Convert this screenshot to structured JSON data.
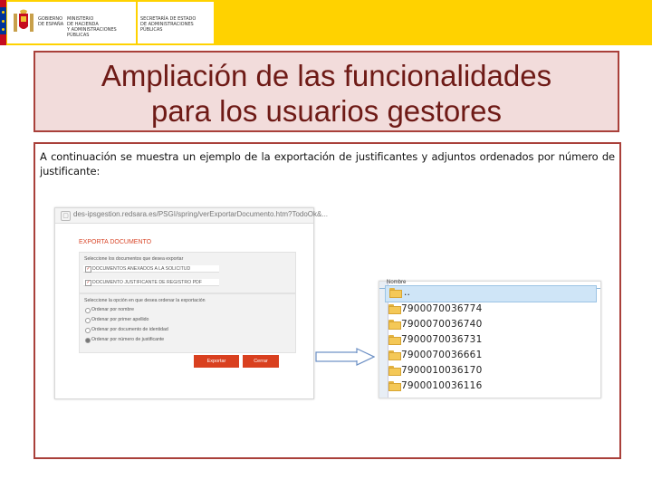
{
  "header": {
    "gov_lines": [
      "GOBIERNO",
      "DE ESPAÑA"
    ],
    "ministry_lines": [
      "MINISTERIO",
      "DE HACIENDA",
      "Y ADMINISTRACIONES PÚBLICAS"
    ],
    "secretariat_lines": [
      "SECRETARÍA DE ESTADO",
      "DE ADMINISTRACIONES PÚBLICAS"
    ],
    "brand_color": "#ffd200"
  },
  "slide": {
    "title_line1": "Ampliación de las funcionalidades",
    "title_line2": "para los usuarios gestores",
    "description": "A continuación se muestra un ejemplo de la exportación de justificantes y adjuntos ordenados por número de justificante:"
  },
  "screenshot1": {
    "url": "des-ipsgestion.redsara.es/PSGI/spring/verExportarDocumento.htm?TodoOk&...",
    "section_title": "EXPORTA DOCUMENTO",
    "docs_prompt": "Seleccione los documentos que desea exportar",
    "doc_options": [
      {
        "label": "DOCUMENTOS ANEXADOS A LA SOLICITUD",
        "checked": true
      },
      {
        "label": "DOCUMENTO JUSTIFICANTE DE REGISTRO PDF",
        "checked": true
      }
    ],
    "order_prompt": "Seleccione la opción en que desea ordenar la exportación",
    "order_options": [
      {
        "label": "Ordenar por nombre",
        "selected": false
      },
      {
        "label": "Ordenar por primer apellido",
        "selected": false
      },
      {
        "label": "Ordenar por documento de identidad",
        "selected": false
      },
      {
        "label": "Ordenar por número de justificante",
        "selected": true
      }
    ],
    "export_button": "Exportar",
    "close_button": "Cerrar"
  },
  "screenshot2": {
    "column_header": "Nombre",
    "parent_folder": "..",
    "folders": [
      "7900070036774",
      "7900070036740",
      "7900070036731",
      "7900070036661",
      "7900010036170",
      "7900010036116"
    ]
  }
}
